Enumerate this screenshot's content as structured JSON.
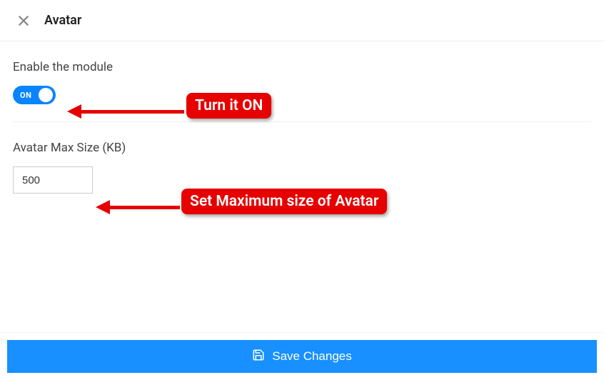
{
  "header": {
    "title": "Avatar"
  },
  "enable": {
    "label": "Enable the module",
    "toggle_state": "ON"
  },
  "maxsize": {
    "label": "Avatar Max Size (KB)",
    "value": "500"
  },
  "footer": {
    "save_label": "Save Changes"
  },
  "annotations": {
    "turn_on": "Turn it ON",
    "set_max": "Set Maximum size of Avatar"
  }
}
